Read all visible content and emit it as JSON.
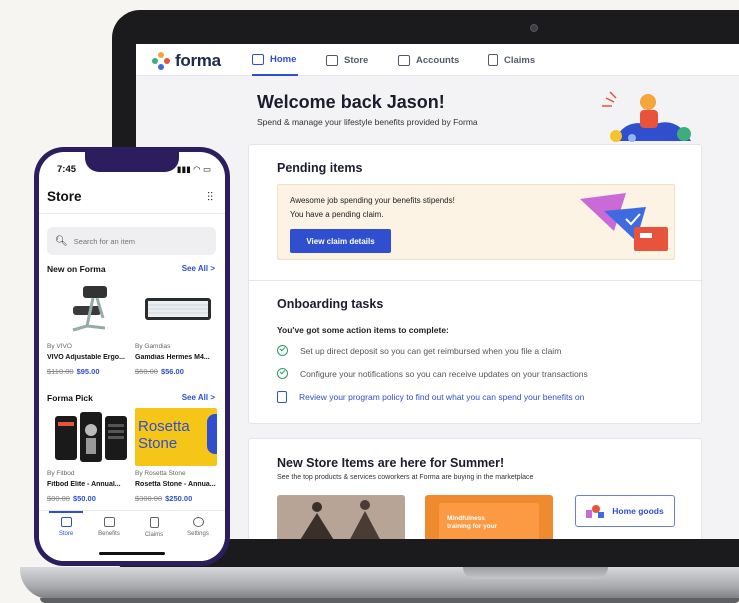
{
  "laptop": {
    "brand": "forma",
    "nav_tabs": [
      {
        "label": "Home",
        "active": true
      },
      {
        "label": "Store",
        "active": false
      },
      {
        "label": "Accounts",
        "active": false
      },
      {
        "label": "Claims",
        "active": false
      }
    ],
    "welcome_title": "Welcome back Jason!",
    "welcome_subtitle": "Spend & manage your lifestyle benefits provided by Forma",
    "pending": {
      "title": "Pending items",
      "line1": "Awesome job spending your benefits stipends!",
      "line2": "You have a pending claim.",
      "button": "View claim details"
    },
    "onboarding": {
      "title": "Onboarding tasks",
      "subtitle": "You've got some action items to complete:",
      "tasks": [
        "Set up direct deposit so you can get reimbursed when you file a claim",
        "Configure your notifications so you can receive updates on your transactions",
        "Review your program policy to find out what you can spend your benefits on"
      ]
    },
    "store_promo": {
      "title": "New Store Items are here for Summer!",
      "subtitle": "See the top products & services coworkers at Forma are buying in the marketplace",
      "category": "Home goods",
      "thumb2_text": "Mindfulness training for your"
    }
  },
  "phone": {
    "time": "7:45",
    "status_icons": "▮▮▮ ◠ ▭",
    "title": "Store",
    "search_placeholder": "Search for an item",
    "sections": [
      {
        "title": "New on Forma",
        "see_all": "See All >",
        "products": [
          {
            "brand": "By VIVO",
            "name": "VIVO Adjustable Ergo...",
            "old_price": "$110.00",
            "price": "$95.00"
          },
          {
            "brand": "By Gamdias",
            "name": "Gamdias Hermes M4...",
            "old_price": "$60.00",
            "price": "$56.00"
          }
        ]
      },
      {
        "title": "Forma Pick",
        "see_all": "See All >",
        "products": [
          {
            "brand": "By Fitbod",
            "name": "Fitbod Elite - Annual...",
            "old_price": "$80.00",
            "price": "$50.00"
          },
          {
            "brand": "By Rosetta Stone",
            "name": "Rosetta Stone - Annua...",
            "old_price": "$300.00",
            "price": "$250.00"
          }
        ]
      }
    ],
    "rosetta_logo": "Rosetta Stone",
    "tabbar": [
      {
        "label": "Store",
        "active": true
      },
      {
        "label": "Benefits",
        "active": false
      },
      {
        "label": "Claims",
        "active": false
      },
      {
        "label": "Settings",
        "active": false
      }
    ]
  }
}
